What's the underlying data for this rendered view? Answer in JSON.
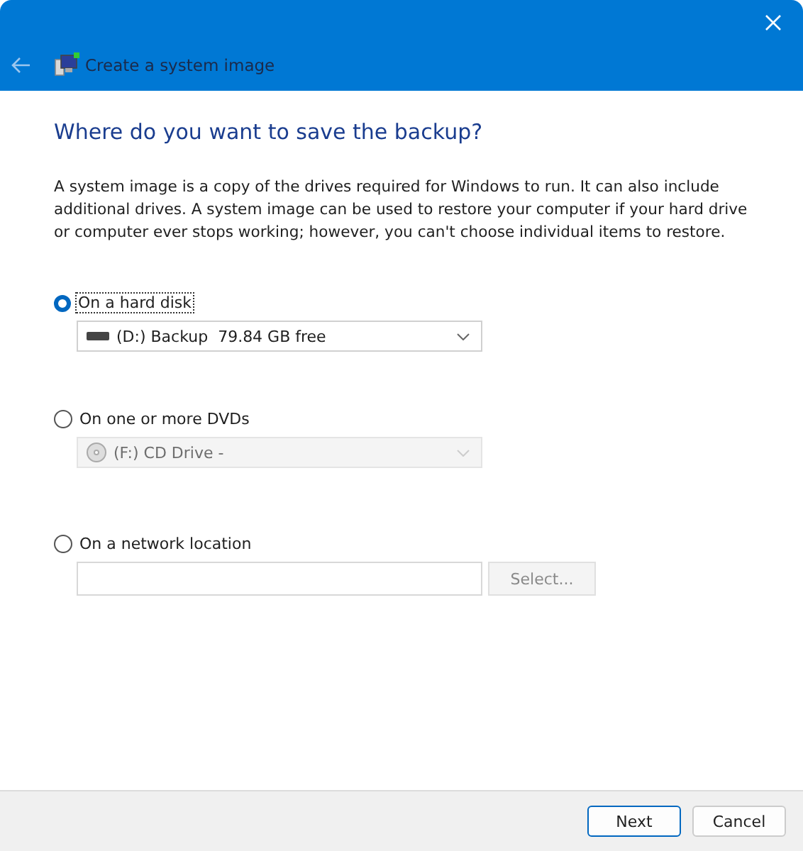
{
  "window": {
    "title": "Create a system image"
  },
  "heading": "Where do you want to save the backup?",
  "description": "A system image is a copy of the drives required for Windows to run. It can also include additional drives. A system image can be used to restore your computer if your hard drive or computer ever stops working; however, you can't choose individual items to restore.",
  "options": [
    {
      "kind": "dropdown",
      "label": "On a hard disk",
      "selected": true,
      "focused": true,
      "control": {
        "value": "(D:) Backup  79.84 GB free",
        "disabled": false
      }
    },
    {
      "kind": "dropdown",
      "label": "On one or more DVDs",
      "selected": false,
      "focused": false,
      "control": {
        "value": "(F:) CD Drive -",
        "disabled": true
      }
    },
    {
      "kind": "path",
      "label": "On a network location",
      "selected": false,
      "focused": false,
      "control": {
        "button": "Select...",
        "disabled": true
      }
    }
  ],
  "buttons": [
    {
      "label": "Next",
      "default": true
    },
    {
      "label": "Cancel",
      "default": false
    }
  ]
}
